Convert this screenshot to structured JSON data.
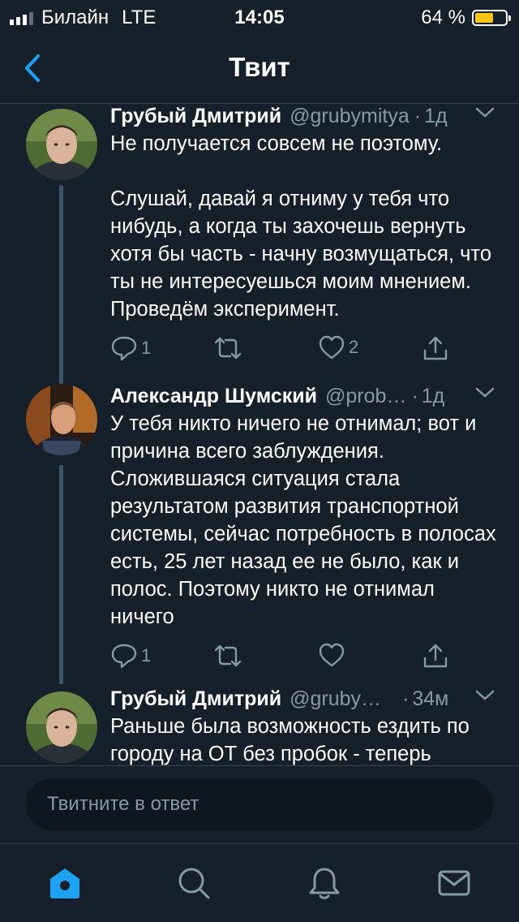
{
  "status": {
    "carrier": "Билайн",
    "network": "LTE",
    "time": "14:05",
    "battery": "64 %",
    "battery_level": 0.64
  },
  "nav": {
    "title": "Твит",
    "back_icon": "chevron-left-icon"
  },
  "tweets": [
    {
      "name": "Грубый Дмитрий",
      "handle": "@grubymitya",
      "dot": "·",
      "time": "1д",
      "text": "Не получается совсем не поэтому.\n\nСлушай, давай я отниму у тебя что нибудь, а когда ты захочешь вернуть хотя бы часть - начну возмущаться, что ты не интересуешься моим мнением. Проведём эксперимент.",
      "replies": "1",
      "retweets": "",
      "likes": "2"
    },
    {
      "name": "Александр Шумский",
      "handle": "@prob…",
      "dot": "·",
      "time": "1д",
      "text": "У тебя никто ничего не отнимал; вот и причина всего заблуждения. Сложившаяся ситуация стала результатом развития транспортной системы, сейчас потребность в полосах есть, 25 лет назад ее не было, как и полос. Поэтому никто не отнимал ничего",
      "replies": "1",
      "retweets": "",
      "likes": ""
    },
    {
      "name": "Грубый Дмитрий",
      "handle": "@gruby…",
      "dot": "·",
      "time": "34м",
      "text": "Раньше была возможность ездить по городу на ОТ без пробок - теперь"
    }
  ],
  "reply": {
    "placeholder": "Твитните в ответ"
  },
  "tabs": [
    "home-icon",
    "search-icon",
    "notifications-icon",
    "messages-icon"
  ],
  "colors": {
    "background": "#15202b",
    "accent": "#1da1f2",
    "secondary_text": "#8899a6",
    "divider": "#38444d"
  }
}
